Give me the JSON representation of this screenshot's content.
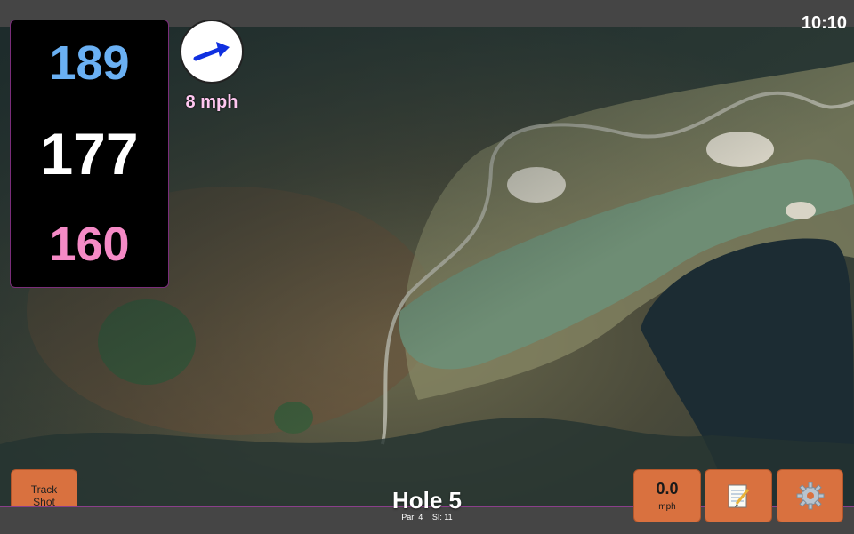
{
  "status": {
    "time": "10:10"
  },
  "distances": {
    "back": "189",
    "middle": "177",
    "front": "160"
  },
  "wind": {
    "speed": "8 mph",
    "direction_icon": "wind-arrow-icon"
  },
  "hole": {
    "title": "Hole 5",
    "par": "Par: 4",
    "si": "SI: 11"
  },
  "buttons": {
    "track_shot": {
      "line1": "Track",
      "line2": "Shot"
    },
    "speed": {
      "value": "0.0",
      "unit": "mph"
    },
    "notes_icon": "notepad-icon",
    "settings_icon": "gear-icon"
  },
  "colors": {
    "accent_border": "#8a3f8a",
    "button": "#d9713f",
    "back_distance": "#6ab0f3",
    "front_distance": "#f58ac6"
  }
}
